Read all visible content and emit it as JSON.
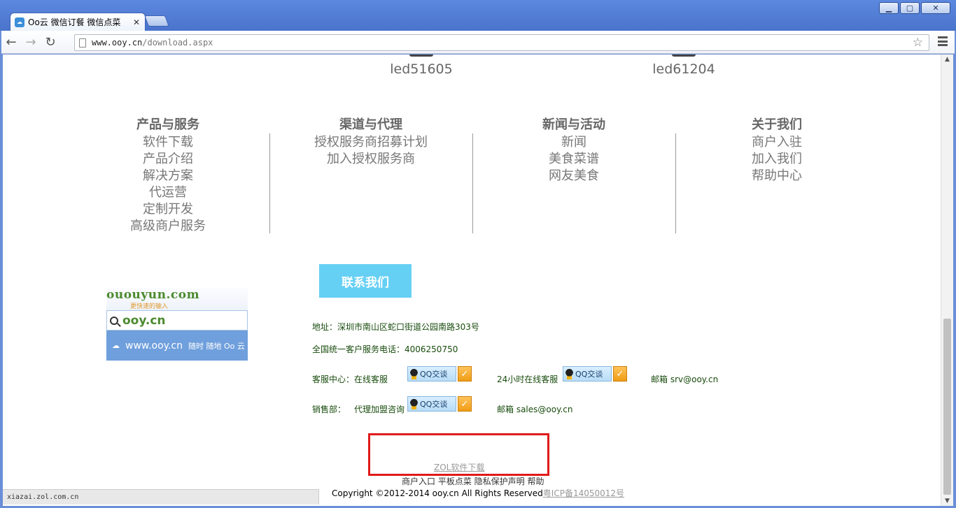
{
  "browser": {
    "tab_title": "Oo云 微信订餐 微信点菜",
    "url_host": "www.ooy.cn",
    "url_path": "/download.aspx",
    "status_url": "xiazai.zol.com.cn"
  },
  "products": {
    "models": [
      "led51605",
      "led61204"
    ]
  },
  "nav": {
    "columns": [
      {
        "title": "产品与服务",
        "links": [
          "软件下载",
          "产品介绍",
          "解决方案",
          "代运营",
          "定制开发",
          "高级商户服务"
        ]
      },
      {
        "title": "渠道与代理",
        "links": [
          "授权服务商招募计划",
          "加入授权服务商"
        ]
      },
      {
        "title": "新闻与活动",
        "links": [
          "新闻",
          "美食菜谱",
          "网友美食"
        ]
      },
      {
        "title": "关于我们",
        "links": [
          "商户入驻",
          "加入我们",
          "帮助中心"
        ]
      }
    ]
  },
  "logo": {
    "brand": "ououyun.com",
    "slogan": "更快速的输入",
    "search_text": "ooy.cn",
    "url_text": "www.ooy.cn",
    "tagline": "随时 随地 Oo 云"
  },
  "contact": {
    "button_label": "联系我们",
    "address": "地址：深圳市南山区蛇口街道公园南路303号",
    "hotline": "全国统一客户服务电话：4006250750",
    "service_label": "客服中心：在线客服",
    "service_24h_label": "24小时在线客服",
    "service_email": "邮箱 srv@ooy.cn",
    "sales_label": "销售部：",
    "sales_agent_label": "代理加盟咨询",
    "sales_email": "邮箱 sales@ooy.cn",
    "qq_button_label": "QQ交谈"
  },
  "footer": {
    "zol_link": "ZOL软件下载",
    "links_text": "商户入口 平板点菜 隐私保护声明 帮助",
    "copyright": "Copyright ©2012-2014 ooy.cn All Rights Reserved",
    "icp": "粤ICP备14050012号"
  },
  "colors": {
    "contact_button": "#66d0f4",
    "highlight_box": "#e01b1b",
    "contact_text": "#174b0c"
  }
}
